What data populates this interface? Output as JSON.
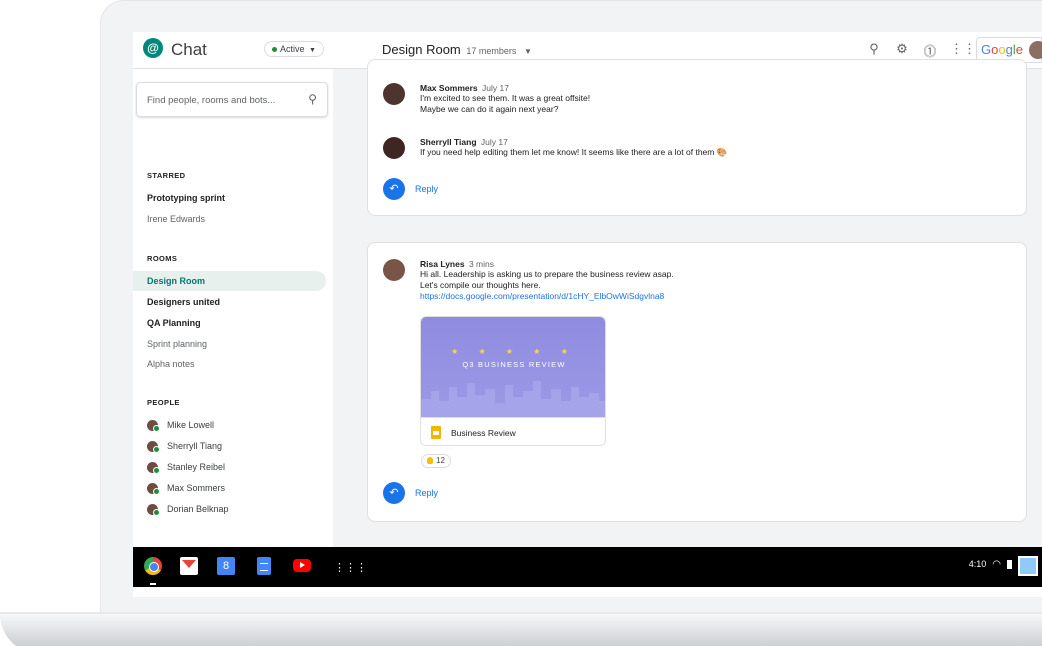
{
  "app": {
    "title": "Chat",
    "status": "Active"
  },
  "header": {
    "room_title": "Design Room",
    "members": "17 members",
    "google_label": {
      "g1": "G",
      "g2": "o",
      "g3": "o",
      "g4": "g",
      "g5": "l",
      "g6": "e"
    }
  },
  "sidebar": {
    "search_placeholder": "Find people, rooms and bots...",
    "starred_label": "STARRED",
    "starred": [
      "Prototyping sprint",
      "Irene Edwards"
    ],
    "rooms_label": "ROOMS",
    "rooms": [
      "Design Room",
      "Designers united",
      "QA Planning",
      "Sprint planning",
      "Alpha notes"
    ],
    "people_label": "PEOPLE",
    "people": [
      "Mike Lowell",
      "Sherryll Tiang",
      "Stanley Reibel",
      "Max Sommers",
      "Dorian Belknap"
    ]
  },
  "thread1": {
    "messages": [
      {
        "name": "Max Sommers",
        "time": "July 17",
        "lines": [
          "I'm excited to see them. It was a great offsite!",
          "Maybe we can do it again next year?"
        ]
      },
      {
        "name": "Sherryll Tiang",
        "time": "July 17",
        "lines": [
          "If you need help editing them let me know! It seems like there are a lot of them 🎨"
        ]
      }
    ],
    "reply_label": "Reply"
  },
  "thread2": {
    "message": {
      "name": "Risa Lynes",
      "time": "3 mins",
      "lines": [
        "Hi all. Leadership is asking us to prepare the business review asap.",
        "Let's compile our thoughts here."
      ],
      "link": "https://docs.google.com/presentation/d/1cHY_ElbOwWiSdgvlna8"
    },
    "preview": {
      "stars": "★ ★ ★ ★ ★",
      "title": "Q3 BUSINESS REVIEW",
      "label": "Business Review"
    },
    "reaction_count": "12",
    "reply_label": "Reply"
  },
  "shelf": {
    "time": "4:10",
    "launcher_glyph": "⋮⋮⋮",
    "gplus": "8"
  },
  "colors": {
    "accent": "#00796b",
    "link": "#1a73e8",
    "active_green": "#1e8e3e",
    "preview_purple": "#8f8ce0"
  }
}
